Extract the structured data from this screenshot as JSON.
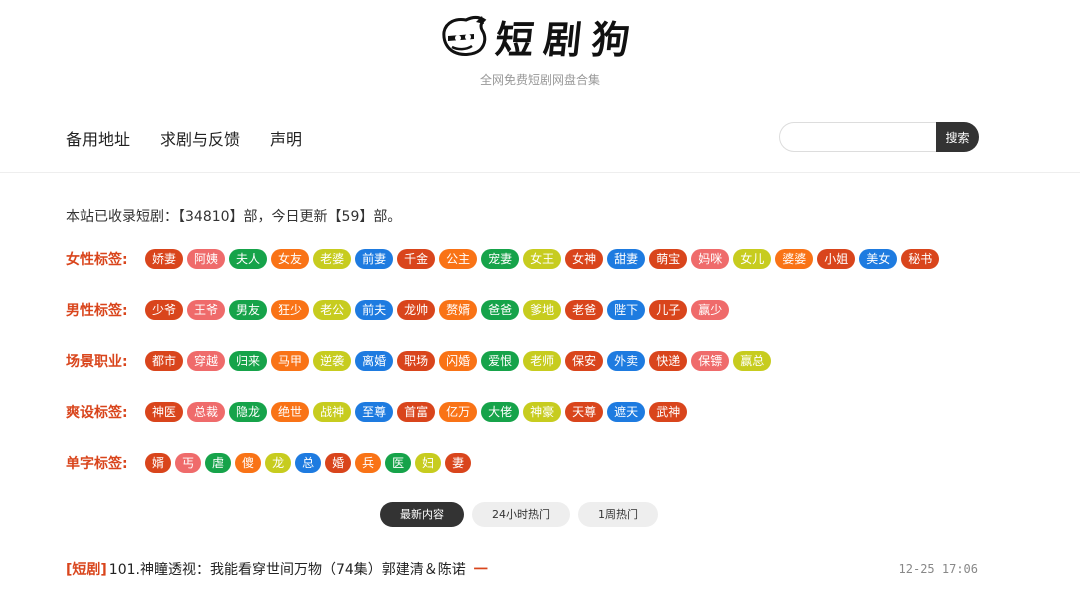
{
  "header": {
    "logo_text": "短剧狗",
    "subtitle": "全网免费短剧网盘合集"
  },
  "nav": [
    {
      "label": "备用地址"
    },
    {
      "label": "求剧与反馈"
    },
    {
      "label": "声明"
    }
  ],
  "search": {
    "placeholder": "",
    "button_label": "搜索"
  },
  "stats_text": "本站已收录短剧：【34810】部，今日更新【59】部。",
  "tag_groups": [
    {
      "label": "女性标签:",
      "tags": [
        {
          "text": "娇妻",
          "color": "#d9451c"
        },
        {
          "text": "阿姨",
          "color": "#ef6b6b"
        },
        {
          "text": "夫人",
          "color": "#16a34a"
        },
        {
          "text": "女友",
          "color": "#f97316"
        },
        {
          "text": "老婆",
          "color": "#c7cc1f"
        },
        {
          "text": "前妻",
          "color": "#1e7be0"
        },
        {
          "text": "千金",
          "color": "#d9451c"
        },
        {
          "text": "公主",
          "color": "#f97316"
        },
        {
          "text": "宠妻",
          "color": "#16a34a"
        },
        {
          "text": "女王",
          "color": "#c7cc1f"
        },
        {
          "text": "女神",
          "color": "#d9451c"
        },
        {
          "text": "甜妻",
          "color": "#1e7be0"
        },
        {
          "text": "萌宝",
          "color": "#d9451c"
        },
        {
          "text": "妈咪",
          "color": "#ef6b6b"
        },
        {
          "text": "女儿",
          "color": "#c7cc1f"
        },
        {
          "text": "婆婆",
          "color": "#f97316"
        },
        {
          "text": "小姐",
          "color": "#d9451c"
        },
        {
          "text": "美女",
          "color": "#1e7be0"
        },
        {
          "text": "秘书",
          "color": "#d9451c"
        }
      ]
    },
    {
      "label": "男性标签:",
      "tags": [
        {
          "text": "少爷",
          "color": "#d9451c"
        },
        {
          "text": "王爷",
          "color": "#ef6b6b"
        },
        {
          "text": "男友",
          "color": "#16a34a"
        },
        {
          "text": "狂少",
          "color": "#f97316"
        },
        {
          "text": "老公",
          "color": "#c7cc1f"
        },
        {
          "text": "前夫",
          "color": "#1e7be0"
        },
        {
          "text": "龙帅",
          "color": "#d9451c"
        },
        {
          "text": "赘婿",
          "color": "#f97316"
        },
        {
          "text": "爸爸",
          "color": "#16a34a"
        },
        {
          "text": "爹地",
          "color": "#c7cc1f"
        },
        {
          "text": "老爸",
          "color": "#d9451c"
        },
        {
          "text": "陛下",
          "color": "#1e7be0"
        },
        {
          "text": "儿子",
          "color": "#d9451c"
        },
        {
          "text": "赢少",
          "color": "#ef6b6b"
        }
      ]
    },
    {
      "label": "场景职业:",
      "tags": [
        {
          "text": "都市",
          "color": "#d9451c"
        },
        {
          "text": "穿越",
          "color": "#ef6b6b"
        },
        {
          "text": "归来",
          "color": "#16a34a"
        },
        {
          "text": "马甲",
          "color": "#f97316"
        },
        {
          "text": "逆袭",
          "color": "#c7cc1f"
        },
        {
          "text": "离婚",
          "color": "#1e7be0"
        },
        {
          "text": "职场",
          "color": "#d9451c"
        },
        {
          "text": "闪婚",
          "color": "#f97316"
        },
        {
          "text": "爱恨",
          "color": "#16a34a"
        },
        {
          "text": "老师",
          "color": "#c7cc1f"
        },
        {
          "text": "保安",
          "color": "#d9451c"
        },
        {
          "text": "外卖",
          "color": "#1e7be0"
        },
        {
          "text": "快递",
          "color": "#d9451c"
        },
        {
          "text": "保镖",
          "color": "#ef6b6b"
        },
        {
          "text": "赢总",
          "color": "#c7cc1f"
        }
      ]
    },
    {
      "label": "爽设标签:",
      "tags": [
        {
          "text": "神医",
          "color": "#d9451c"
        },
        {
          "text": "总裁",
          "color": "#ef6b6b"
        },
        {
          "text": "隐龙",
          "color": "#16a34a"
        },
        {
          "text": "绝世",
          "color": "#f97316"
        },
        {
          "text": "战神",
          "color": "#c7cc1f"
        },
        {
          "text": "至尊",
          "color": "#1e7be0"
        },
        {
          "text": "首富",
          "color": "#d9451c"
        },
        {
          "text": "亿万",
          "color": "#f97316"
        },
        {
          "text": "大佬",
          "color": "#16a34a"
        },
        {
          "text": "神豪",
          "color": "#c7cc1f"
        },
        {
          "text": "天尊",
          "color": "#d9451c"
        },
        {
          "text": "遮天",
          "color": "#1e7be0"
        },
        {
          "text": "武神",
          "color": "#d9451c"
        }
      ]
    },
    {
      "label": "单字标签:",
      "tags": [
        {
          "text": "婿",
          "color": "#d9451c"
        },
        {
          "text": "丐",
          "color": "#ef6b6b"
        },
        {
          "text": "虐",
          "color": "#16a34a"
        },
        {
          "text": "傻",
          "color": "#f97316"
        },
        {
          "text": "龙",
          "color": "#c7cc1f"
        },
        {
          "text": "总",
          "color": "#1e7be0"
        },
        {
          "text": "婚",
          "color": "#d9451c"
        },
        {
          "text": "兵",
          "color": "#f97316"
        },
        {
          "text": "医",
          "color": "#16a34a"
        },
        {
          "text": "妇",
          "color": "#c7cc1f"
        },
        {
          "text": "妻",
          "color": "#d9451c"
        }
      ]
    }
  ],
  "tabs": [
    {
      "label": "最新内容",
      "active": true
    },
    {
      "label": "24小时热门",
      "active": false
    },
    {
      "label": "1周热门",
      "active": false
    }
  ],
  "list": [
    {
      "category": "[短剧]",
      "title": "101.神瞳透视：我能看穿世间万物（74集）郭建清＆陈诺",
      "mark": "一",
      "time": "12-25 17:06"
    }
  ]
}
